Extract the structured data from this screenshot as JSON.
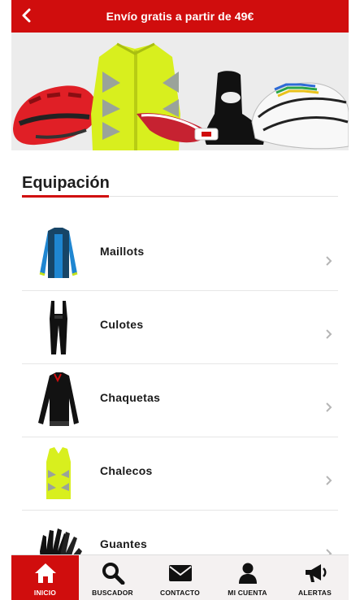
{
  "header": {
    "title": "Envío gratis a partir de 49€",
    "back_icon": "chevron-left-icon"
  },
  "banner": {
    "image": "cycling-gear-banner",
    "items": [
      "bike-helmet-red",
      "hi-vis-jacket",
      "sport-sunglasses",
      "overshoes",
      "bike-helmet-white"
    ],
    "colors": {
      "background": "#ececec"
    }
  },
  "section": {
    "title": "Equipación"
  },
  "categories": [
    {
      "label": "Maillots",
      "icon": "jersey-thumbnail",
      "chevron": "chevron-right-icon"
    },
    {
      "label": "Culotes",
      "icon": "bib-tights-thumbnail",
      "chevron": "chevron-right-icon"
    },
    {
      "label": "Chaquetas",
      "icon": "jacket-thumbnail",
      "chevron": "chevron-right-icon"
    },
    {
      "label": "Chalecos",
      "icon": "vest-thumbnail",
      "chevron": "chevron-right-icon"
    },
    {
      "label": "Guantes",
      "icon": "gloves-thumbnail",
      "chevron": "chevron-right-icon"
    }
  ],
  "tabbar": {
    "active": "inicio",
    "tabs": [
      {
        "id": "inicio",
        "label": "INICIO",
        "icon": "home-icon"
      },
      {
        "id": "buscador",
        "label": "BUSCADOR",
        "icon": "search-icon"
      },
      {
        "id": "contacto",
        "label": "CONTACTO",
        "icon": "envelope-icon"
      },
      {
        "id": "cuenta",
        "label": "MI CUENTA",
        "icon": "user-icon"
      },
      {
        "id": "alertas",
        "label": "ALERTAS",
        "icon": "megaphone-icon"
      }
    ]
  },
  "colors": {
    "brand": "#d00d0d",
    "tabbar_bg": "#f4f1f1",
    "text": "#1a1a1a"
  }
}
